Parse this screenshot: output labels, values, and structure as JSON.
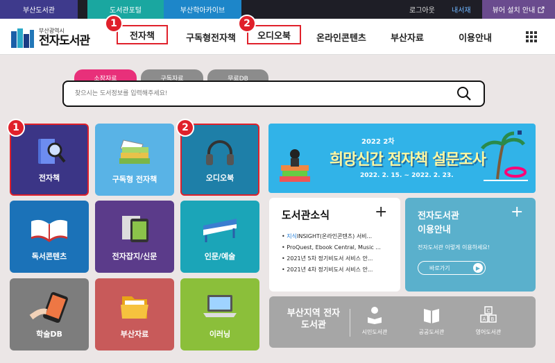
{
  "topbar": {
    "tabs": [
      "부산도서관",
      "도서관포털",
      "부산학아카이브"
    ],
    "logout": "로그아웃",
    "mylib": "내서재",
    "viewer": "뷰어 설치 안내"
  },
  "header": {
    "logo_small": "부산광역시",
    "logo_big": "전자도서관",
    "nav": [
      "전자책",
      "구독형전자책",
      "오디오북",
      "온라인콘텐츠",
      "부산자료",
      "이용안내"
    ],
    "badges": [
      "1",
      "2"
    ]
  },
  "search": {
    "tabs": [
      "소장자료",
      "구독자료",
      "무료DB"
    ],
    "placeholder": "찾으시는 도서정보를 입력해주세요!"
  },
  "tiles": [
    {
      "label": "전자책",
      "icon": "ebook-magnifier-icon"
    },
    {
      "label": "구독형 전자책",
      "icon": "book-stack-icon"
    },
    {
      "label": "오디오북",
      "icon": "headphones-icon"
    },
    {
      "label": "독서콘텐츠",
      "icon": "open-book-icon"
    },
    {
      "label": "전자잡지/신문",
      "icon": "magazine-tablet-icon"
    },
    {
      "label": "인문/예술",
      "icon": "piano-icon"
    },
    {
      "label": "학술DB",
      "icon": "smartphone-icon"
    },
    {
      "label": "부산자료",
      "icon": "folder-icon"
    },
    {
      "label": "이러닝",
      "icon": "laptop-icon"
    }
  ],
  "tile_badges": [
    "1",
    "2"
  ],
  "banner": {
    "year": "2022  2차",
    "title": "희망신간 전자책 설문조사",
    "date": "2022. 2. 15. ~ 2022. 2. 23."
  },
  "news": {
    "title": "도서관소식",
    "items": [
      {
        "highlight": "지식",
        "text": "INSIGHT(온라인콘텐츠) 서비..."
      },
      {
        "highlight": "",
        "text": "ProQuest, Ebook Central, Music ..."
      },
      {
        "highlight": "",
        "text": "2021년 5차 정기비도서 서비스 안..."
      },
      {
        "highlight": "",
        "text": "2021년 4차 정기비도서 서비스 안..."
      }
    ]
  },
  "guide": {
    "title1": "전자도서관",
    "title2": "이용안내",
    "desc": "전자도서관 이렇게 이용하세요!",
    "button": "바로가기"
  },
  "region": {
    "title": "부산지역 전자도서관",
    "items": [
      "시민도서관",
      "공공도서관",
      "영어도서관"
    ]
  },
  "colors": {
    "red": "#e0202a",
    "pink": "#e8307a",
    "navy_tile": "#3b3586"
  }
}
